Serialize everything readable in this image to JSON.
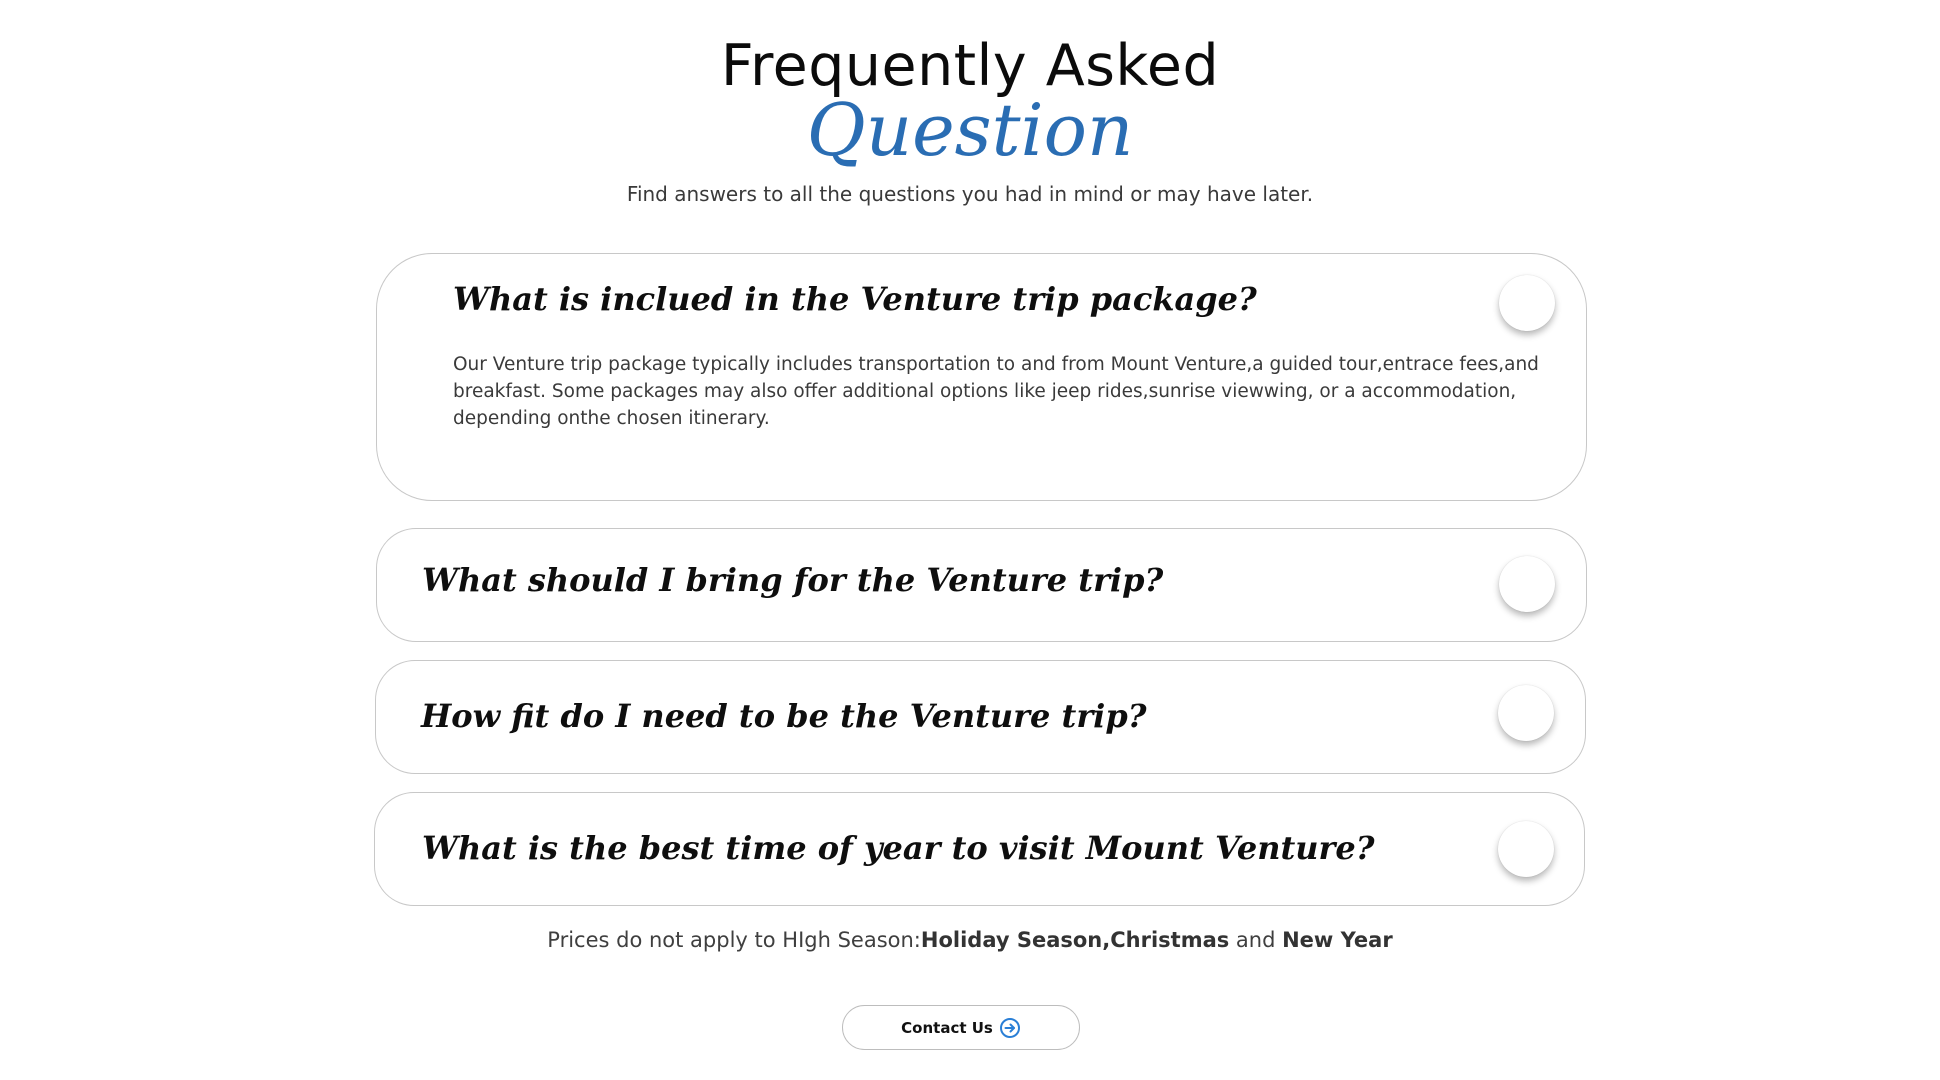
{
  "header": {
    "title_line1": "Frequently Asked",
    "title_line2": "Question",
    "subtitle": "Find answers to all the questions you had in mind or may have later."
  },
  "faq": [
    {
      "question": "What is inclued in the Venture trip package?",
      "answer": "Our Venture trip package typically includes transportation to and from Mount Venture,a guided tour,entrace fees,and breakfast. Some packages may also offer additional options like jeep rides,sunrise viewwing, or a accommodation, depending onthe chosen itinerary.",
      "expanded": true
    },
    {
      "question": "What should I bring for the Venture trip?",
      "expanded": false
    },
    {
      "question": "How fit do I need to be the Venture trip?",
      "expanded": false
    },
    {
      "question": "What is the best time of year to visit Mount Venture?",
      "expanded": false
    }
  ],
  "note": {
    "prefix": "Prices do not apply to HIgh Season:",
    "highlight1": "Holiday Season,Christmas",
    "middle": " and ",
    "highlight2": "New Year"
  },
  "contact": {
    "label": "Contact Us",
    "icon": "arrow-right-circle-icon"
  },
  "colors": {
    "accent": "#2a6db3",
    "border": "#c8c8c8",
    "text": "#111111",
    "muted": "#3a3a3a"
  }
}
